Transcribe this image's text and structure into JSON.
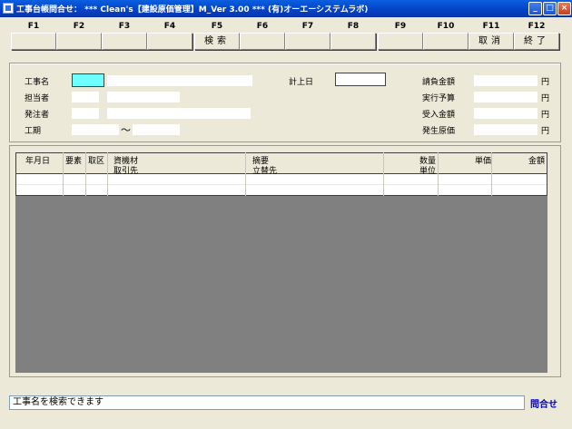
{
  "window": {
    "title": "工事台帳問合せ： *** Clean's【建設原価管理】M_Ver 3.00 *** (有)オーエーシステムラボ)"
  },
  "fkeys": [
    {
      "key": "F1",
      "label": ""
    },
    {
      "key": "F2",
      "label": ""
    },
    {
      "key": "F3",
      "label": ""
    },
    {
      "key": "F4",
      "label": ""
    },
    {
      "key": "F5",
      "label": "検索"
    },
    {
      "key": "F6",
      "label": ""
    },
    {
      "key": "F7",
      "label": ""
    },
    {
      "key": "F8",
      "label": ""
    },
    {
      "key": "F9",
      "label": ""
    },
    {
      "key": "F10",
      "label": ""
    },
    {
      "key": "F11",
      "label": "取消"
    },
    {
      "key": "F12",
      "label": "終了"
    }
  ],
  "form": {
    "project_name_label": "工事名",
    "manager_label": "担当者",
    "orderer_label": "発注者",
    "period_label": "工期",
    "period_sep": "〜",
    "posting_date_label": "計上日",
    "contract_amount_label": "請負金額",
    "budget_label": "実行予算",
    "received_amount_label": "受入金額",
    "actual_cost_label": "発生原価",
    "yen": "円"
  },
  "grid": {
    "headers": {
      "date": "年月日",
      "element": "要素",
      "category": "取区",
      "material": "資機材",
      "supplier": "取引先",
      "summary": "摘要",
      "advance_payee": "立替先",
      "quantity": "数量",
      "unit": "単位",
      "unit_price": "単価",
      "amount": "金額"
    }
  },
  "status": {
    "message": "工事名を検索できます",
    "mode": "問合せ"
  }
}
